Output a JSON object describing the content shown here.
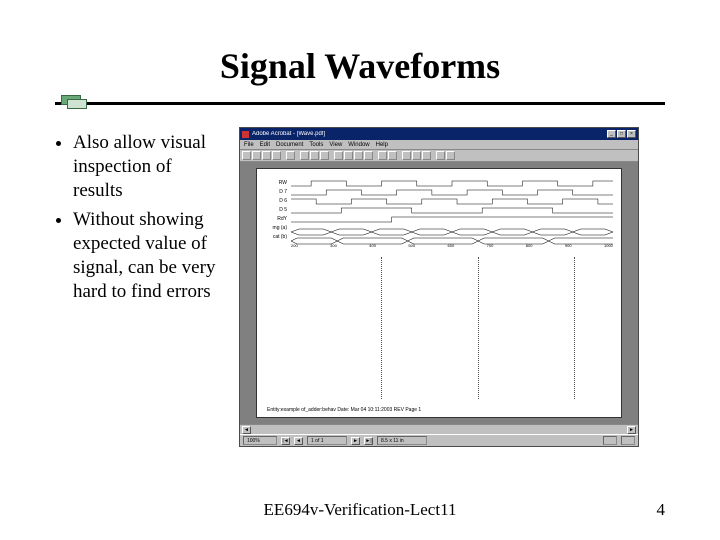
{
  "title": "Signal Waveforms",
  "bullets": [
    "Also allow visual inspection of results",
    "Without showing expected value of signal, can be very hard to find errors"
  ],
  "footer": "EE694v-Verification-Lect11",
  "page_number": "4",
  "app": {
    "title": "Adobe Acrobat - [Wave.pdf]",
    "menus": [
      "File",
      "Edit",
      "Document",
      "Tools",
      "View",
      "Window",
      "Help"
    ],
    "winbtns": {
      "min": "_",
      "max": "□",
      "close": "×"
    }
  },
  "waveform": {
    "signals": [
      "RW",
      "D 7",
      "D 6",
      "D 5",
      "RdY",
      "",
      "mg  (a)",
      "cat  (b)"
    ],
    "time_ticks": [
      "200",
      "300",
      "400",
      "500",
      "600",
      "700",
      "800",
      "900",
      "1000"
    ],
    "page_caption": "Entity:example of_adder:behav   Date: Mar 04  10:11:2003 REV  Page 1"
  },
  "statusbar": {
    "zoom": "100%",
    "page": "1 of 1",
    "size": "8.5 x 11 in"
  }
}
